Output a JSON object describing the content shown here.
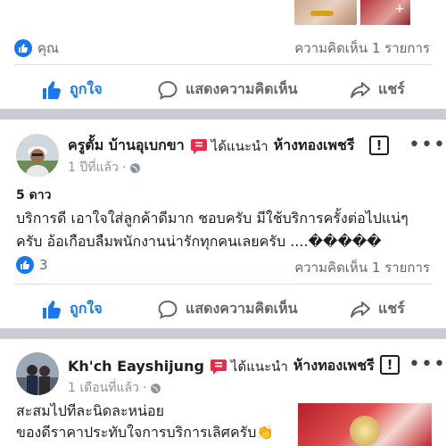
{
  "post1": {
    "reactor_name": "คุณ",
    "comments_count": "ความคิดเห็น 1 รายการ",
    "actions": {
      "like": "ถูกใจ",
      "comment": "แสดงความคิดเห็น",
      "share": "แชร์"
    }
  },
  "post2": {
    "author": "ครูตั้ม บ้านอุเบกขา",
    "recommends": "ได้แนะนำ",
    "page_name": "ห้างทองเพชรี",
    "time": "1 ปีที่แล้ว",
    "rating": "5 ดาว",
    "text": "บริการดี เอาใจใส่ลูกค้าดีมาก ชอบครับ มีใช้บริการครั้งต่อไปแน่ๆ ครับ อ้อเกือบลืมพนักงานน่ารักทุกคนเลยครับ ....�����",
    "likes_count": "3",
    "comments_count": "ความคิดเห็น 1 รายการ",
    "actions": {
      "like": "ถูกใจ",
      "comment": "แสดงความคิดเห็น",
      "share": "แชร์"
    }
  },
  "post3": {
    "author": "Kh'ch Eayshijung",
    "recommends": "ได้แนะนำ",
    "page_name": "ห้างทองเพชรี",
    "time": "1 เดือนที่แล้ว",
    "text_line1": "สะสมไปทีละนิดละหน่อย",
    "text_line2": "ของดีราคาประทับใจการบริการเลิศครับ👏"
  },
  "colors": {
    "brand_blue": "#1877f2",
    "recommend_red": "#f02849",
    "separator": "#c9ccd1"
  }
}
